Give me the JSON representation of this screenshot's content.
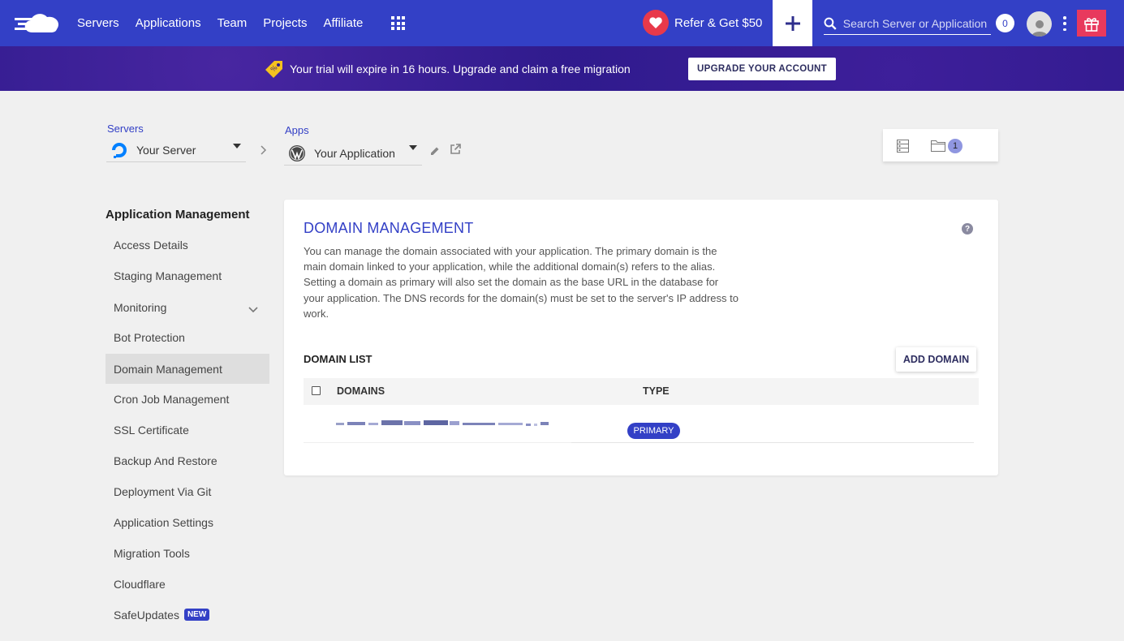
{
  "nav": {
    "links": [
      "Servers",
      "Applications",
      "Team",
      "Projects",
      "Affiliate"
    ],
    "refer_label": "Refer & Get $50",
    "search_placeholder": "Search Server or Application",
    "notification_count": "0"
  },
  "banner": {
    "text": "Your trial will expire in 16 hours. Upgrade and claim a free migration",
    "button_label": "UPGRADE YOUR ACCOUNT"
  },
  "breadcrumb": {
    "servers_label": "Servers",
    "server_value": "Your Server",
    "apps_label": "Apps",
    "app_value": "Your Application"
  },
  "view_toggle": {
    "badge_count": "1"
  },
  "sidebar": {
    "title": "Application Management",
    "items": [
      {
        "label": "Access Details"
      },
      {
        "label": "Staging Management"
      },
      {
        "label": "Monitoring"
      },
      {
        "label": "Bot Protection"
      },
      {
        "label": "Domain Management"
      },
      {
        "label": "Cron Job Management"
      },
      {
        "label": "SSL Certificate"
      },
      {
        "label": "Backup And Restore"
      },
      {
        "label": "Deployment Via Git"
      },
      {
        "label": "Application Settings"
      },
      {
        "label": "Migration Tools"
      },
      {
        "label": "Cloudflare"
      },
      {
        "label": "SafeUpdates",
        "badge": "NEW"
      }
    ],
    "active_item": "Domain Management"
  },
  "main": {
    "title": "DOMAIN MANAGEMENT",
    "help": "?",
    "description": "You can manage the domain associated with your application. The primary domain is the main domain linked to your application, while the additional domain(s) refers to the alias. Setting a domain as primary will also set the domain as the base URL in the database for your application. The DNS records for the domain(s) must be set to the server's IP address to work.",
    "list_title": "DOMAIN LIST",
    "add_button": "ADD DOMAIN",
    "columns": [
      "DOMAINS",
      "TYPE"
    ],
    "rows": [
      {
        "type": "PRIMARY"
      }
    ]
  },
  "colors": {
    "brand": "#3340c6",
    "banner": "#2e1a8c",
    "refer_heart": "#e8394a",
    "gift": "#e8395d"
  }
}
